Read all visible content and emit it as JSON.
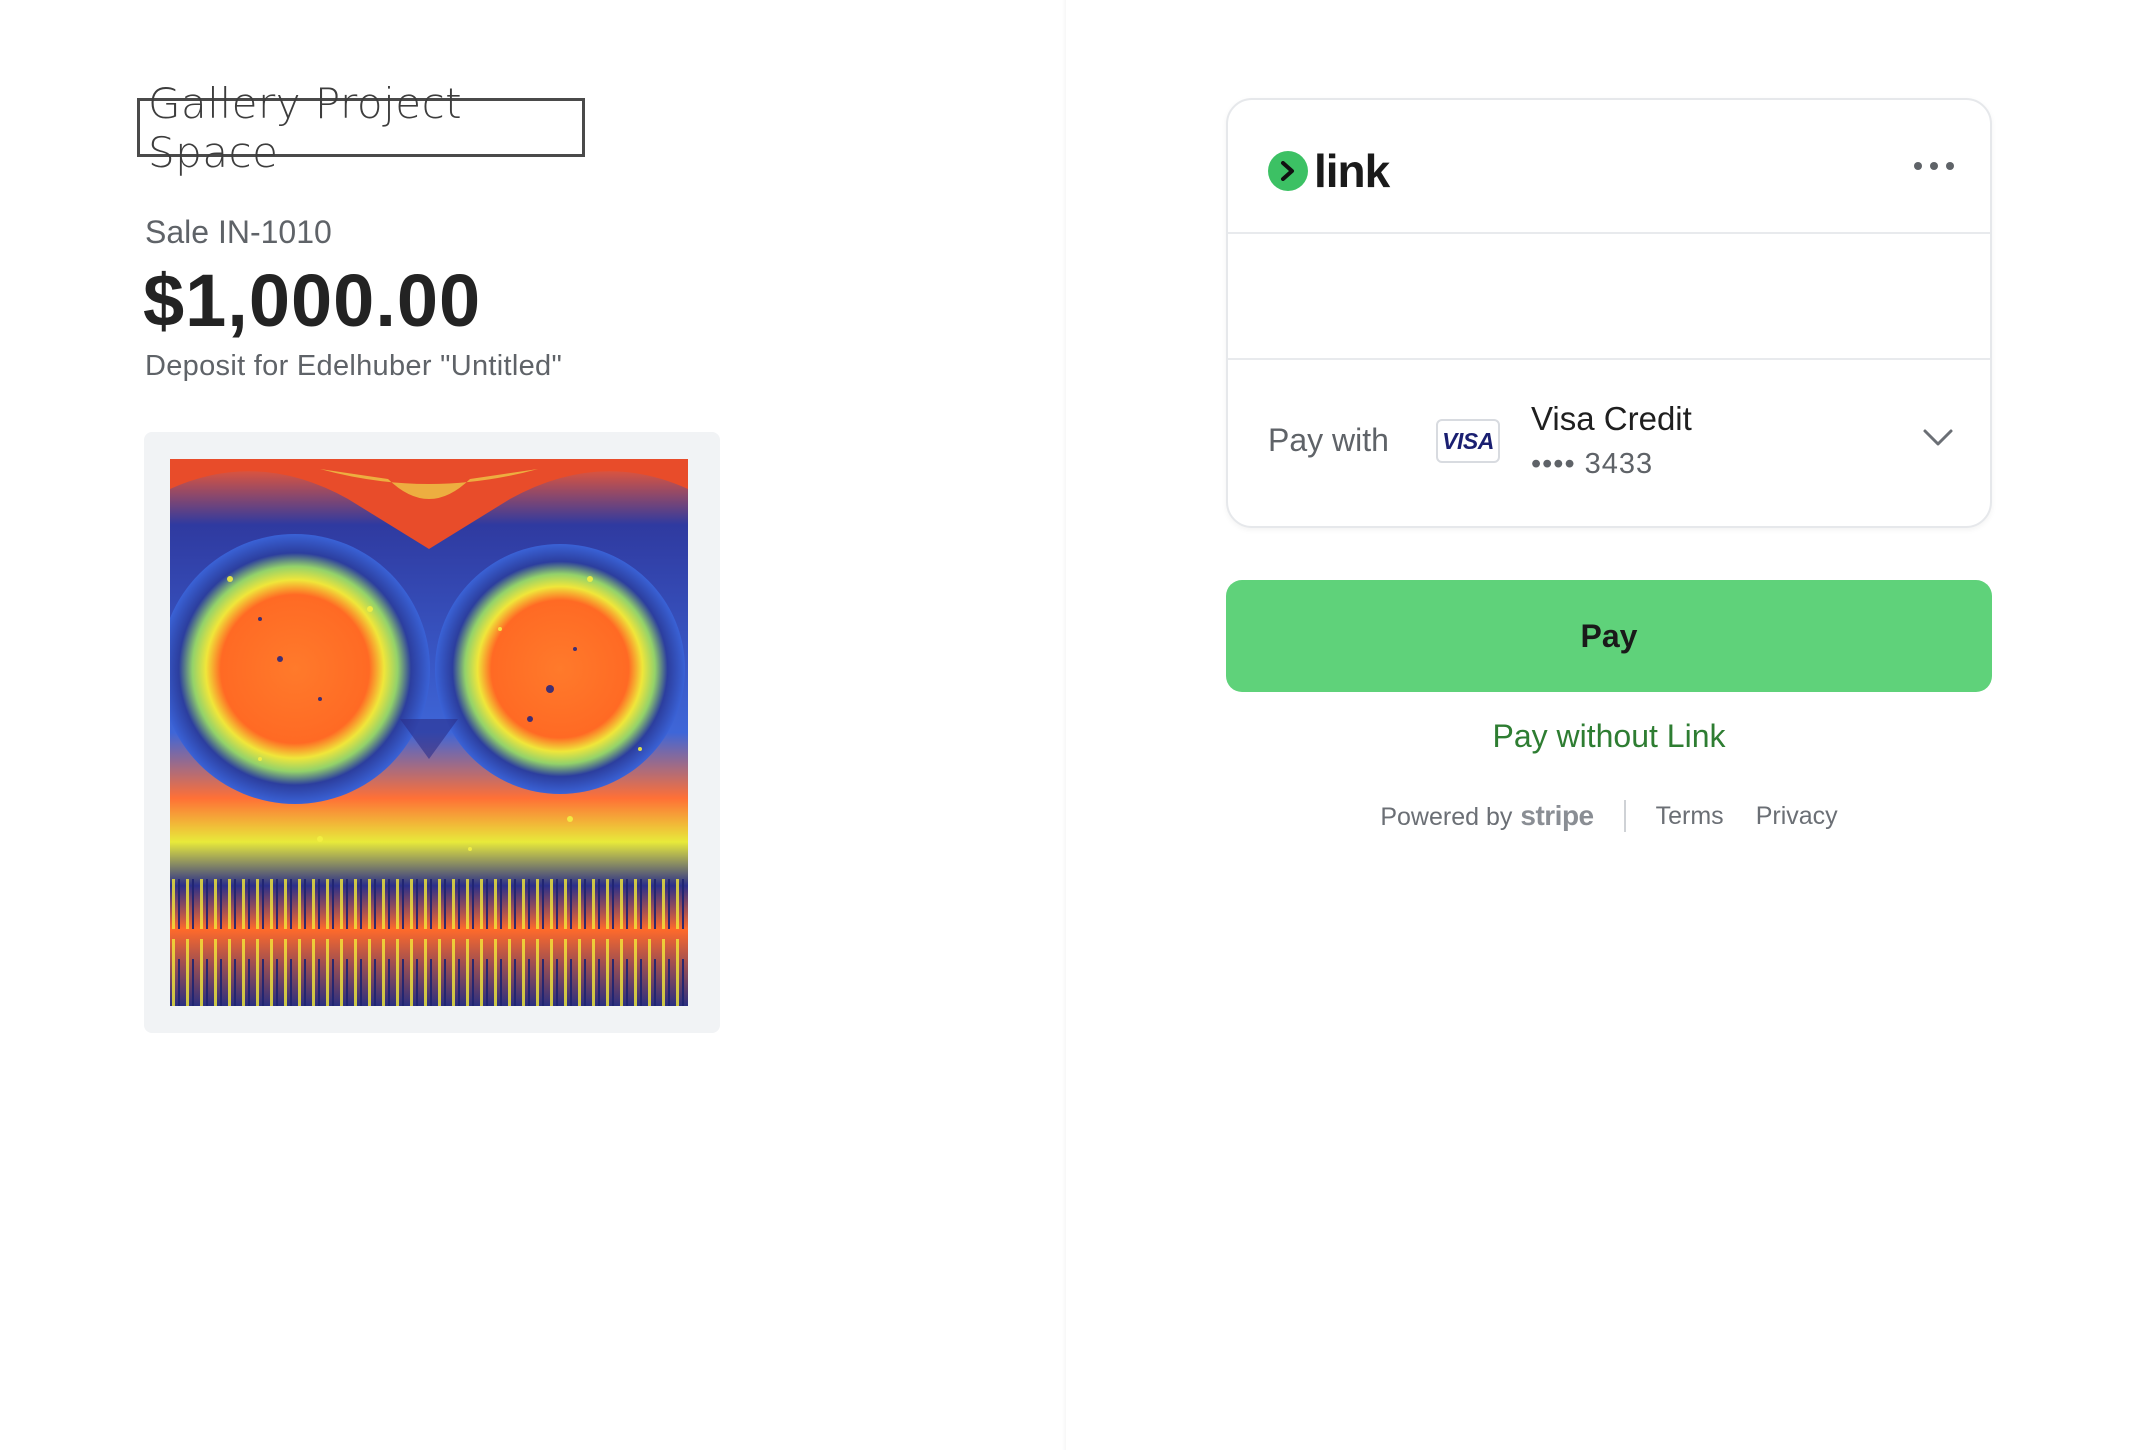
{
  "merchant": {
    "name": "Gallery Project Space"
  },
  "invoice": {
    "sale_id": "Sale IN-1010",
    "amount": "$1,000.00",
    "description": "Deposit for Edelhuber \"Untitled\""
  },
  "artwork": {
    "icon": "artwork-image"
  },
  "link_card": {
    "brand": "link",
    "more_icon": "more-icon",
    "pay_with_label": "Pay with",
    "card_brand": "VISA",
    "card_name": "Visa Credit",
    "card_last4": "•••• 3433",
    "chevron_icon": "chevron-down-icon"
  },
  "actions": {
    "pay_label": "Pay",
    "pay_without_label": "Pay without Link"
  },
  "footer": {
    "powered_by": "Powered by",
    "stripe": "stripe",
    "terms": "Terms",
    "privacy": "Privacy"
  },
  "colors": {
    "pay_button": "#5fd27a",
    "link_green": "#3cc164",
    "pay_without_text": "#2e7d32"
  }
}
